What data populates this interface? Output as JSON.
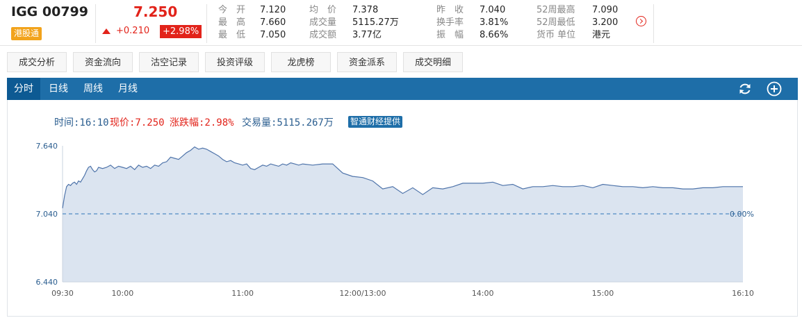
{
  "quote": {
    "name": "IGG 00799",
    "badge": "港股通",
    "price": "7.250",
    "change": "+0.210",
    "change_pct": "+2.98%",
    "stats": [
      {
        "label": "今　开",
        "value": "7.120"
      },
      {
        "label": "最　高",
        "value": "7.660"
      },
      {
        "label": "最　低",
        "value": "7.050"
      },
      {
        "label": "均　价",
        "value": "7.378"
      },
      {
        "label": "成交量",
        "value": "5115.27万"
      },
      {
        "label": "成交额",
        "value": "3.77亿"
      },
      {
        "label": "昨　收",
        "value": "7.040"
      },
      {
        "label": "换手率",
        "value": "3.81%"
      },
      {
        "label": "振　幅",
        "value": "8.66%"
      },
      {
        "label": "52周最高",
        "value": "7.090"
      },
      {
        "label": "52周最低",
        "value": "3.200"
      },
      {
        "label": "货币 单位",
        "value": "港元"
      }
    ],
    "colors": {
      "up": "#e2231a",
      "badge": "#f2a31b"
    }
  },
  "function_buttons": [
    "成交分析",
    "资金流向",
    "沽空记录",
    "投资评级",
    "龙虎榜",
    "资金派系",
    "成交明细"
  ],
  "tabs": [
    {
      "label": "分时",
      "active": true
    },
    {
      "label": "日线",
      "active": false
    },
    {
      "label": "周线",
      "active": false
    },
    {
      "label": "月线",
      "active": false
    }
  ],
  "toolbar_icons": [
    "refresh-icon",
    "add-circle-icon"
  ],
  "info_line": {
    "time_text": "时间:16:10",
    "price_text": "现价:7.250",
    "pct_text": "涨跌幅:2.98%",
    "volume_text": "交易量:5115.267万",
    "source_badge": "智通财经提供"
  },
  "chart_data": {
    "type": "area",
    "title": "",
    "xlabel": "",
    "ylabel": "",
    "x_tick_labels": [
      "09:30",
      "10:00",
      "11:00",
      "12:00/13:00",
      "14:00",
      "15:00",
      "16:10"
    ],
    "y_tick_labels": [
      "7.640",
      "7.040",
      "6.440"
    ],
    "ylim": [
      6.44,
      7.64
    ],
    "baseline": 7.04,
    "baseline_label": "0.00%",
    "grid": false,
    "colors": {
      "line": "#4f74aa",
      "fill": "#dbe4f0",
      "baseline": "#4f8ac4",
      "axis_text": "#2a5d8f"
    },
    "x_axis_minutes": [
      0,
      30,
      90,
      150,
      210,
      270,
      340
    ],
    "series": [
      {
        "x": [
          0,
          1,
          2,
          3,
          4,
          5,
          6,
          7,
          8,
          9,
          10,
          11,
          12,
          13,
          14,
          15,
          16,
          17,
          18,
          20,
          22,
          24,
          26,
          28,
          30,
          32,
          34,
          36,
          38,
          40,
          42,
          44,
          46,
          48,
          50,
          52,
          54,
          56,
          58,
          60,
          62,
          64,
          66,
          68,
          70,
          72,
          74,
          76,
          78,
          80,
          82,
          84,
          86,
          88,
          90,
          92,
          94,
          96,
          98,
          100,
          102,
          104,
          106,
          108,
          110,
          112,
          114,
          116,
          118,
          120,
          125,
          130,
          135,
          140,
          145,
          150,
          155,
          160,
          165,
          170,
          175,
          180,
          185,
          190,
          195,
          200,
          205,
          210,
          215,
          220,
          225,
          230,
          235,
          240,
          245,
          250,
          255,
          260,
          265,
          270,
          275,
          280,
          285,
          290,
          295,
          300,
          305,
          310,
          315,
          320,
          325,
          330,
          335,
          340
        ],
        "y": [
          7.09,
          7.2,
          7.28,
          7.3,
          7.29,
          7.31,
          7.32,
          7.3,
          7.33,
          7.32,
          7.35,
          7.38,
          7.42,
          7.45,
          7.46,
          7.43,
          7.41,
          7.42,
          7.45,
          7.44,
          7.45,
          7.47,
          7.44,
          7.46,
          7.45,
          7.44,
          7.46,
          7.43,
          7.47,
          7.45,
          7.46,
          7.44,
          7.47,
          7.46,
          7.49,
          7.5,
          7.54,
          7.53,
          7.52,
          7.55,
          7.58,
          7.6,
          7.63,
          7.61,
          7.62,
          7.61,
          7.59,
          7.57,
          7.55,
          7.52,
          7.5,
          7.51,
          7.49,
          7.48,
          7.47,
          7.48,
          7.44,
          7.43,
          7.45,
          7.47,
          7.46,
          7.48,
          7.47,
          7.46,
          7.48,
          7.47,
          7.49,
          7.48,
          7.47,
          7.48,
          7.47,
          7.48,
          7.48,
          7.4,
          7.37,
          7.36,
          7.33,
          7.26,
          7.28,
          7.22,
          7.27,
          7.21,
          7.27,
          7.26,
          7.28,
          7.31,
          7.31,
          7.31,
          7.32,
          7.29,
          7.3,
          7.26,
          7.28,
          7.28,
          7.29,
          7.28,
          7.28,
          7.29,
          7.27,
          7.3,
          7.29,
          7.28,
          7.28,
          7.27,
          7.28,
          7.27,
          7.27,
          7.26,
          7.26,
          7.27,
          7.27,
          7.28,
          7.28,
          7.28
        ]
      }
    ]
  }
}
